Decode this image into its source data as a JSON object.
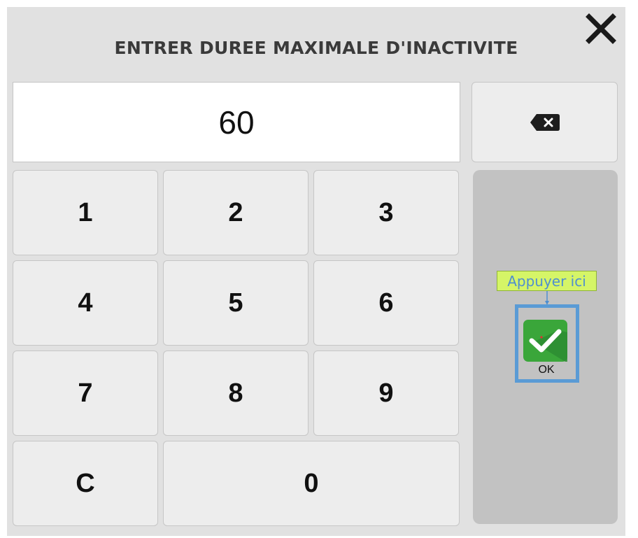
{
  "dialog": {
    "title": "ENTRER DUREE MAXIMALE D'INACTIVITE",
    "close_icon": "close-icon"
  },
  "display": {
    "value": "60"
  },
  "backspace": {
    "icon": "backspace-icon"
  },
  "keypad": {
    "keys": [
      "1",
      "2",
      "3",
      "4",
      "5",
      "6",
      "7",
      "8",
      "9",
      "C",
      "0"
    ]
  },
  "ok": {
    "label": "OK",
    "icon": "checkmark-icon",
    "hint": "Appuyer ici"
  },
  "colors": {
    "dialog_bg": "#e1e1e1",
    "key_bg": "#ededed",
    "panel_bg": "#c2c2c2",
    "ok_green": "#3aa63a",
    "hint_bg": "#d5f567",
    "hint_text": "#4f8fcf",
    "highlight_border": "#5a9bd5"
  }
}
